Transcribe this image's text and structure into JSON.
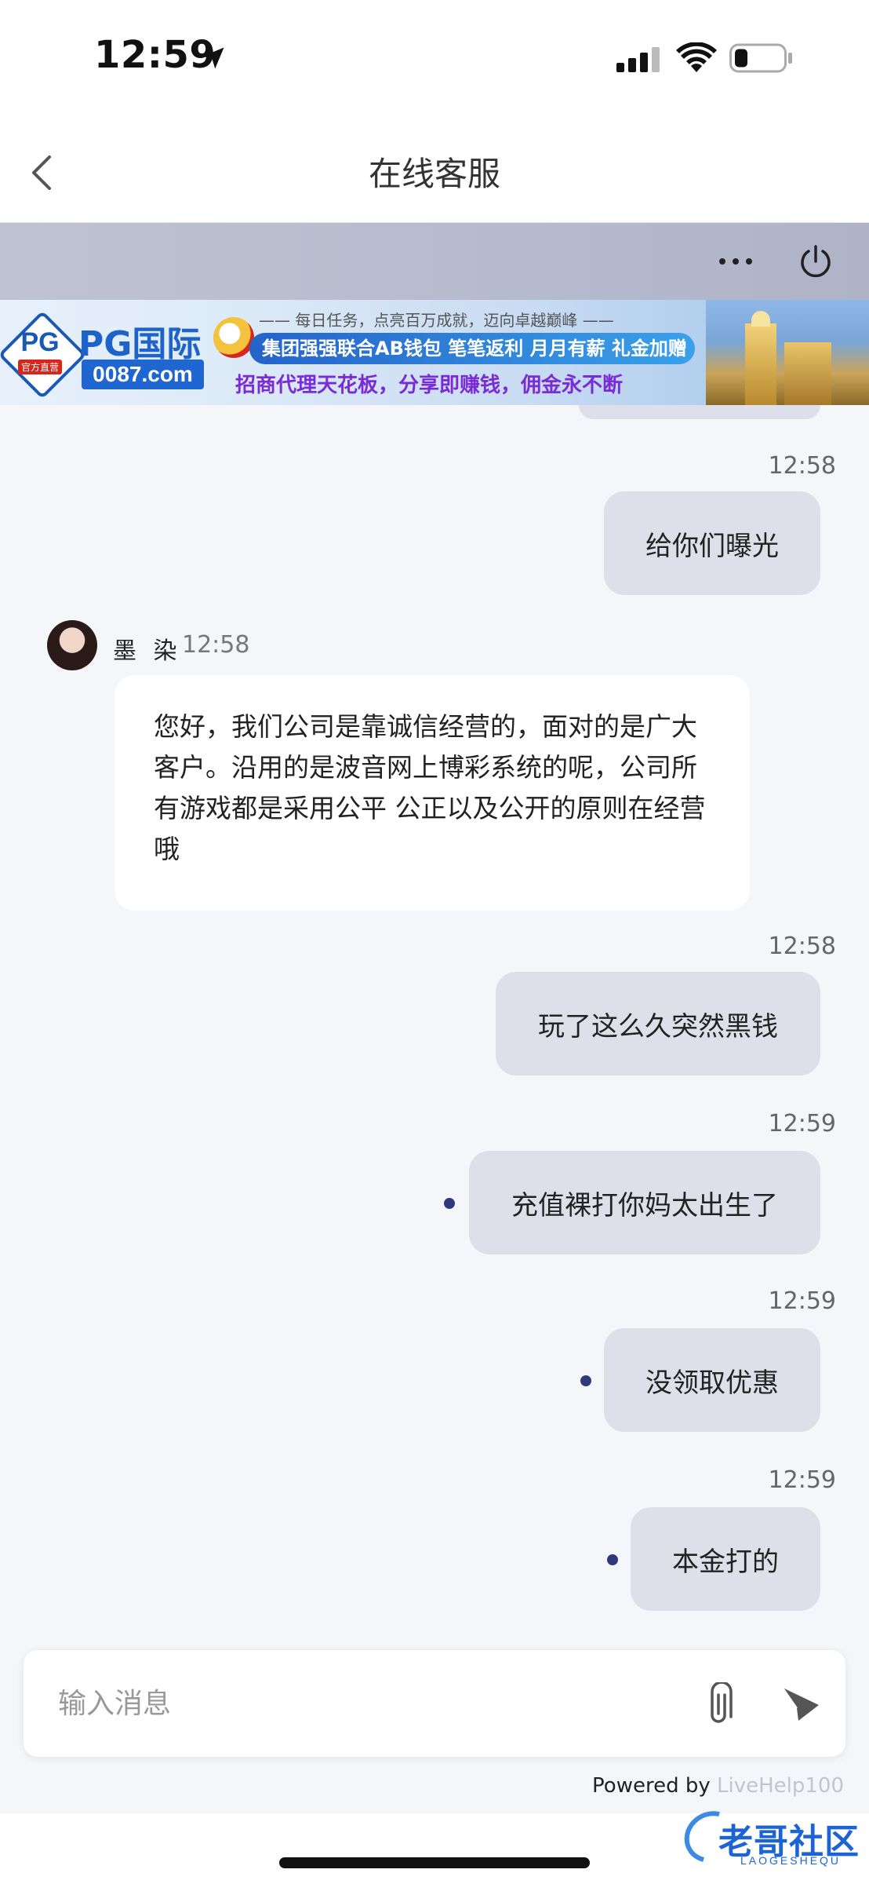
{
  "status_bar": {
    "time": "12:59"
  },
  "nav": {
    "title": "在线客服"
  },
  "banner": {
    "brand": "PG国际",
    "logo_text": "PG",
    "logo_tag": "官方直营",
    "domain": "0087.com",
    "tagline_top": "—— 每日任务，点亮百万成就，迈向卓越巅峰 ——",
    "tagline_mid": "集团强强联合AB钱包 笔笔返利 月月有薪 礼金加赠",
    "tagline_bottom": "招商代理天花板，分享即赚钱，佣金永不断"
  },
  "chat": {
    "agent": {
      "name": "墨 染",
      "time": "12:58"
    },
    "messages": [
      {
        "time": "12:58",
        "text": "给你们曝光"
      },
      {
        "text": "您好，我们公司是靠诚信经营的，面对的是广大客户。沿用的是波音网上博彩系统的呢，公司所有游戏都是采用公平 公正以及公开的原则在经营哦"
      },
      {
        "time": "12:58",
        "text": "玩了这么久突然黑钱"
      },
      {
        "time": "12:59",
        "text": "充值裸打你妈太出生了"
      },
      {
        "time": "12:59",
        "text": "没领取优惠"
      },
      {
        "time": "12:59",
        "text": "本金打的"
      }
    ]
  },
  "input": {
    "placeholder": "输入消息"
  },
  "footer": {
    "powered_prefix": "Powered by ",
    "powered_brand": "LiveHelp100"
  },
  "watermark": {
    "text": "老哥社区",
    "sub": "LAOGESHEQU"
  },
  "colors": {
    "bubble_out": "#dddfe9",
    "bubble_in": "#ffffff",
    "unread_dot": "#2f3a7a",
    "header_band": "#b6bacd"
  }
}
